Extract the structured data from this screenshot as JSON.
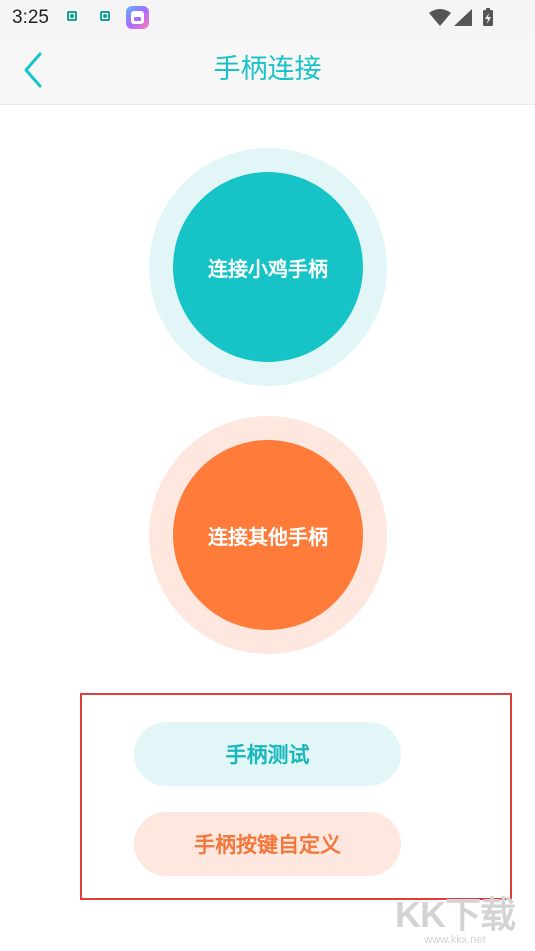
{
  "status_bar": {
    "time": "3:25",
    "icons": [
      "notification-icon",
      "notification-icon",
      "app-icon",
      "wifi-icon",
      "signal-icon",
      "battery-charging-icon"
    ]
  },
  "header": {
    "title": "手柄连接",
    "back_icon": "chevron-left-icon"
  },
  "connect_buttons": {
    "xiaoji": "连接小鸡手柄",
    "other": "连接其他手柄"
  },
  "actions": {
    "test": "手柄测试",
    "custom_keys": "手柄按键自定义"
  },
  "watermark": {
    "logo": "KK下载",
    "url": "www.kkx.net"
  },
  "colors": {
    "accent_teal": "#16c4c7",
    "accent_orange": "#fe7b3a",
    "highlight_red": "#e23c3c"
  }
}
